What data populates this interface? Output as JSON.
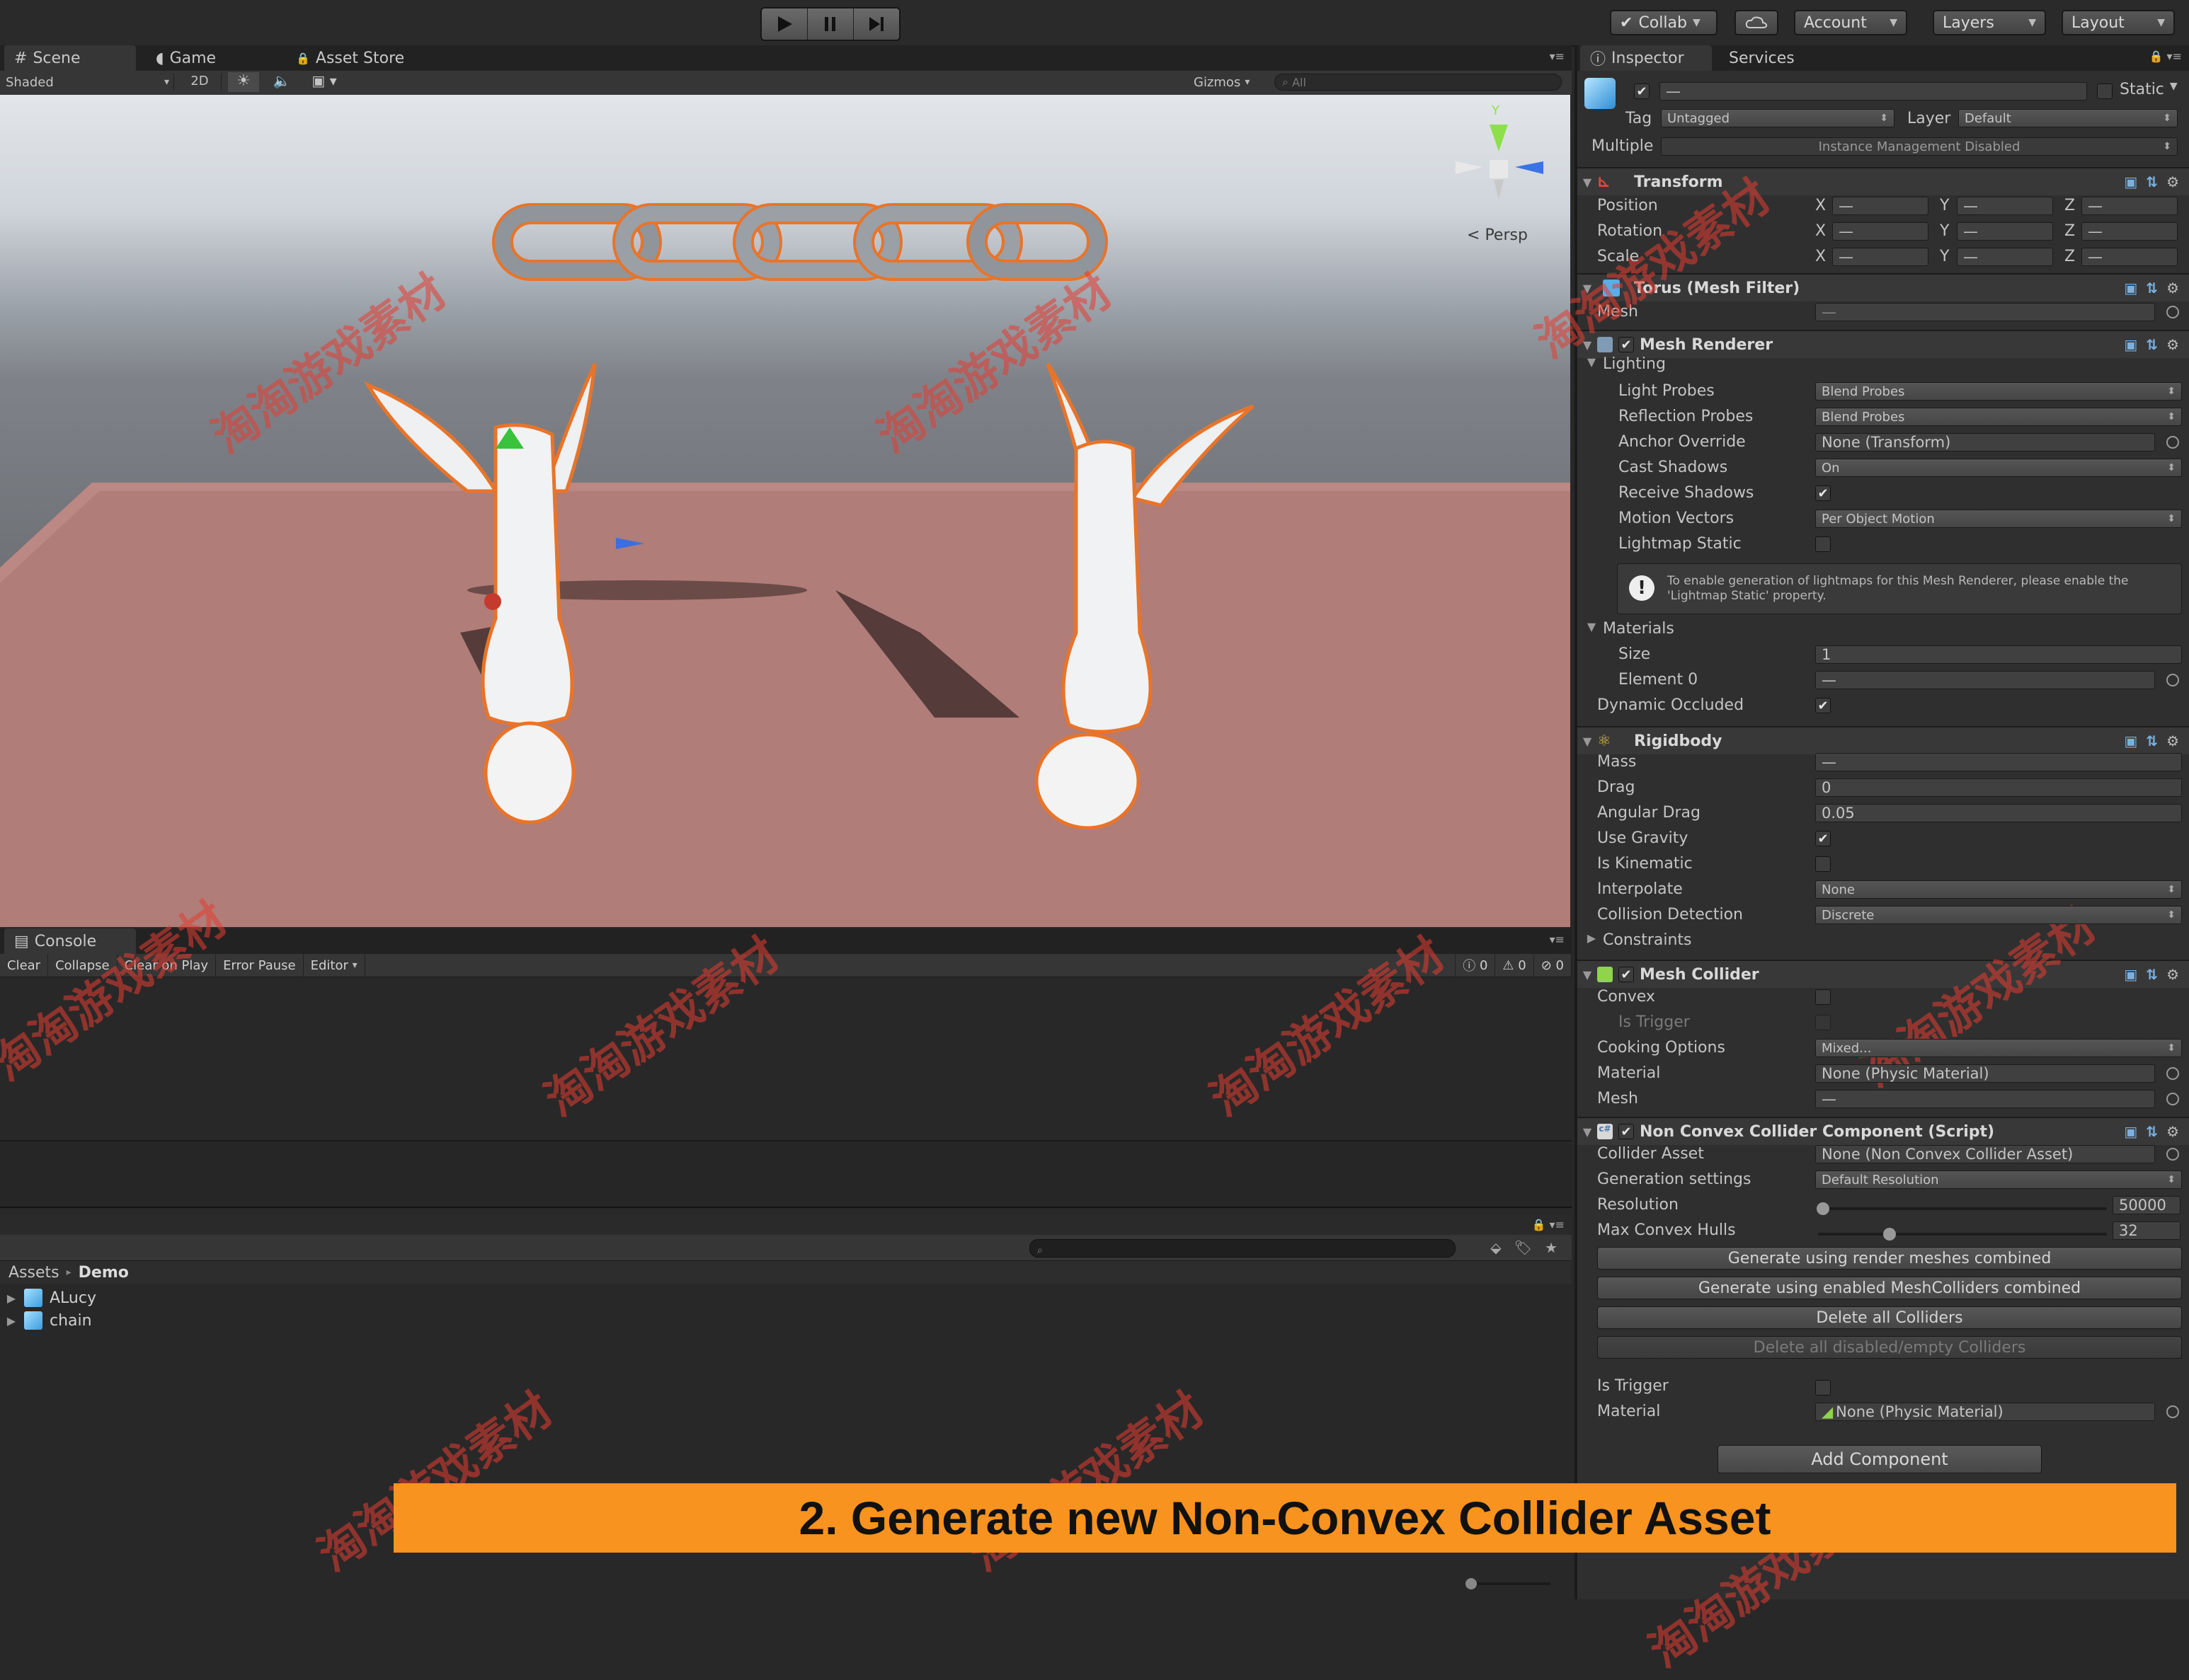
{
  "toolbar": {
    "collab": "Collab",
    "account": "Account",
    "layers": "Layers",
    "layout": "Layout"
  },
  "scene": {
    "tabs": [
      "Scene",
      "Game",
      "Asset Store"
    ],
    "shading": "Shaded",
    "mode_2d": "2D",
    "gizmos": "Gizmos",
    "search_placeholder": "All",
    "persp": "Persp",
    "axis_y": "Y"
  },
  "console": {
    "tab": "Console",
    "clear": "Clear",
    "collapse": "Collapse",
    "clear_on_play": "Clear on Play",
    "error_pause": "Error Pause",
    "editor": "Editor",
    "count_log": "0",
    "count_warn": "0",
    "count_error": "0"
  },
  "project": {
    "breadcrumb_root": "Assets",
    "breadcrumb_sep": "▸",
    "breadcrumb_leaf": "Demo",
    "items": [
      "ALucy",
      "chain"
    ]
  },
  "inspector": {
    "tabs": [
      "Inspector",
      "Services"
    ],
    "name_placeholder": "—",
    "static_label": "Static",
    "tag_label": "Tag",
    "tag_value": "Untagged",
    "layer_label": "Layer",
    "layer_value": "Default",
    "multiple_label": "Multiple",
    "instance_mgmt": "Instance Management Disabled",
    "dash": "—",
    "transform": {
      "title": "Transform",
      "rows": [
        "Position",
        "Rotation",
        "Scale"
      ],
      "axes": [
        "X",
        "Y",
        "Z"
      ]
    },
    "mesh_filter": {
      "title": "Torus (Mesh Filter)",
      "mesh_label": "Mesh"
    },
    "mesh_renderer": {
      "title": "Mesh Renderer",
      "lighting": "Lighting",
      "light_probes": "Light Probes",
      "light_probes_value": "Blend Probes",
      "reflection_probes": "Reflection Probes",
      "reflection_probes_value": "Blend Probes",
      "anchor_override": "Anchor Override",
      "anchor_override_value": "None (Transform)",
      "cast_shadows": "Cast Shadows",
      "cast_shadows_value": "On",
      "receive_shadows": "Receive Shadows",
      "motion_vectors": "Motion Vectors",
      "motion_vectors_value": "Per Object Motion",
      "lightmap_static": "Lightmap Static",
      "info": "To enable generation of lightmaps for this Mesh Renderer, please enable the 'Lightmap Static' property.",
      "materials": "Materials",
      "size": "Size",
      "size_value": "1",
      "element0": "Element 0",
      "dynamic_occluded": "Dynamic Occluded"
    },
    "rigidbody": {
      "title": "Rigidbody",
      "mass": "Mass",
      "drag": "Drag",
      "drag_value": "0",
      "angular_drag": "Angular Drag",
      "angular_drag_value": "0.05",
      "use_gravity": "Use Gravity",
      "is_kinematic": "Is Kinematic",
      "interpolate": "Interpolate",
      "interpolate_value": "None",
      "collision_detection": "Collision Detection",
      "collision_detection_value": "Discrete",
      "constraints": "Constraints"
    },
    "mesh_collider": {
      "title": "Mesh Collider",
      "convex": "Convex",
      "is_trigger": "Is Trigger",
      "cooking_options": "Cooking Options",
      "cooking_options_value": "Mixed...",
      "material": "Material",
      "material_value": "None (Physic Material)",
      "mesh": "Mesh"
    },
    "non_convex": {
      "title": "Non Convex Collider Component (Script)",
      "collider_asset": "Collider Asset",
      "collider_asset_value": "None (Non Convex Collider Asset)",
      "generation_settings": "Generation settings",
      "generation_settings_value": "Default Resolution",
      "resolution": "Resolution",
      "resolution_value": "50000",
      "max_convex_hulls": "Max Convex Hulls",
      "max_convex_hulls_value": "32",
      "btn_render_meshes": "Generate using render meshes combined",
      "btn_mesh_colliders": "Generate using enabled MeshColliders combined",
      "btn_delete_all": "Delete all Colliders",
      "btn_delete_disabled": "Delete all disabled/empty Colliders",
      "is_trigger": "Is Trigger",
      "material": "Material",
      "material_value": "None (Physic Material)"
    },
    "add_component": "Add Component"
  },
  "caption": "2. Generate new Non-Convex Collider Asset",
  "watermark": "淘淘游戏素材",
  "colors": {
    "accent_orange": "#f8931f",
    "selection_outline": "#e8742a",
    "floor": "#b07d78"
  }
}
